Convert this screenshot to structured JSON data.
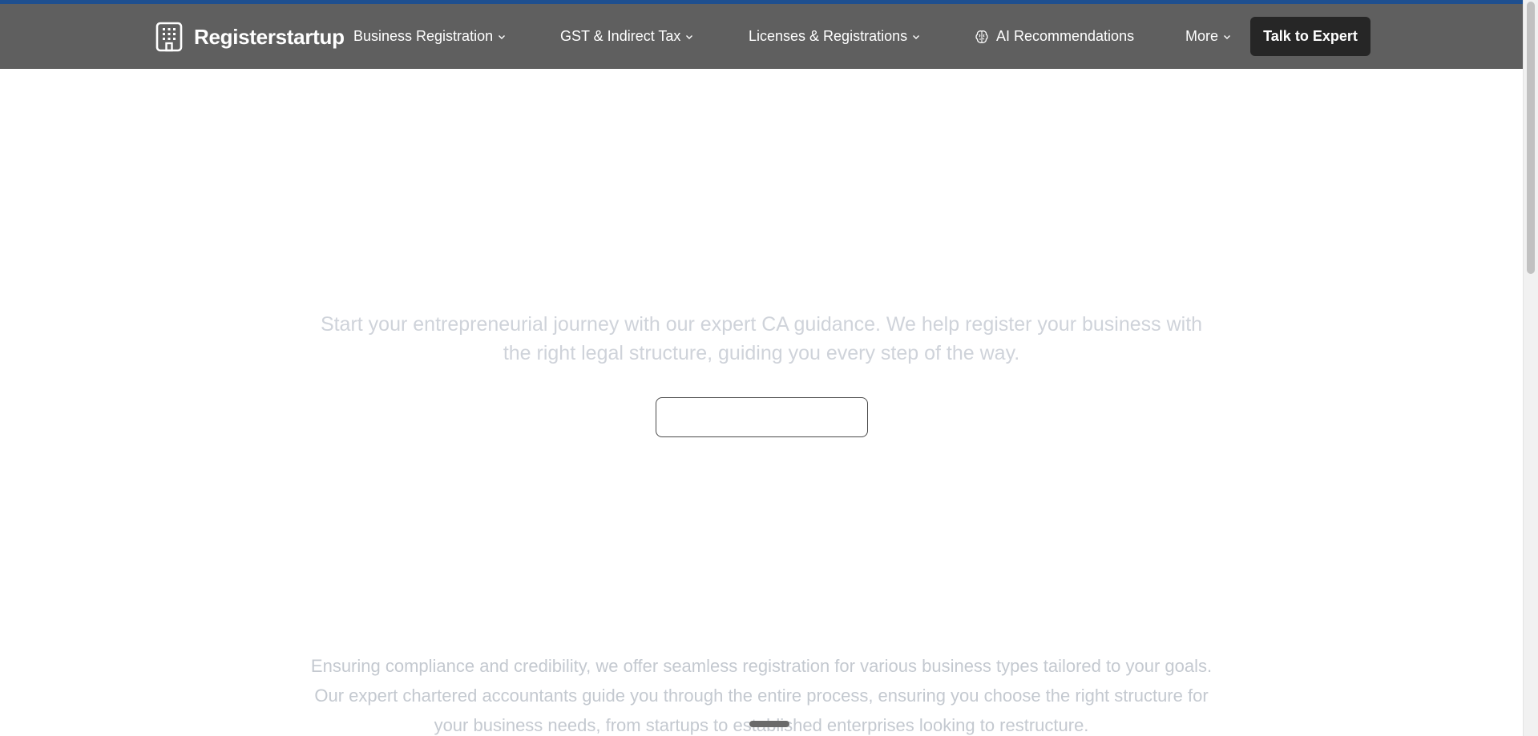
{
  "brand": {
    "name": "Registerstartup",
    "icon": "building-icon"
  },
  "nav": {
    "items": [
      {
        "label": "Business Registration",
        "icon": "chevron-down-icon"
      },
      {
        "label": "GST & Indirect Tax",
        "icon": "chevron-down-icon"
      },
      {
        "label": "Licenses & Registrations",
        "icon": "chevron-down-icon"
      },
      {
        "label": "AI Recommendations",
        "icon": "brain-icon"
      },
      {
        "label": "More",
        "icon": "chevron-down-icon"
      }
    ],
    "cta_label": "Talk to Expert"
  },
  "hero": {
    "subtitle": "Start your entrepreneurial journey with our expert CA guidance. We help register your business with the right legal structure, guiding you every step of the way.",
    "button_label": ""
  },
  "section": {
    "description": "Ensuring compliance and credibility, we offer seamless registration for various business types tailored to your goals. Our expert chartered accountants guide you through the entire process, ensuring you choose the right structure for your business needs, from startups to established enterprises looking to restructure."
  },
  "colors": {
    "accent": "#1e4f8f",
    "navbar": "#5f5f5f",
    "cta": "#262626"
  }
}
